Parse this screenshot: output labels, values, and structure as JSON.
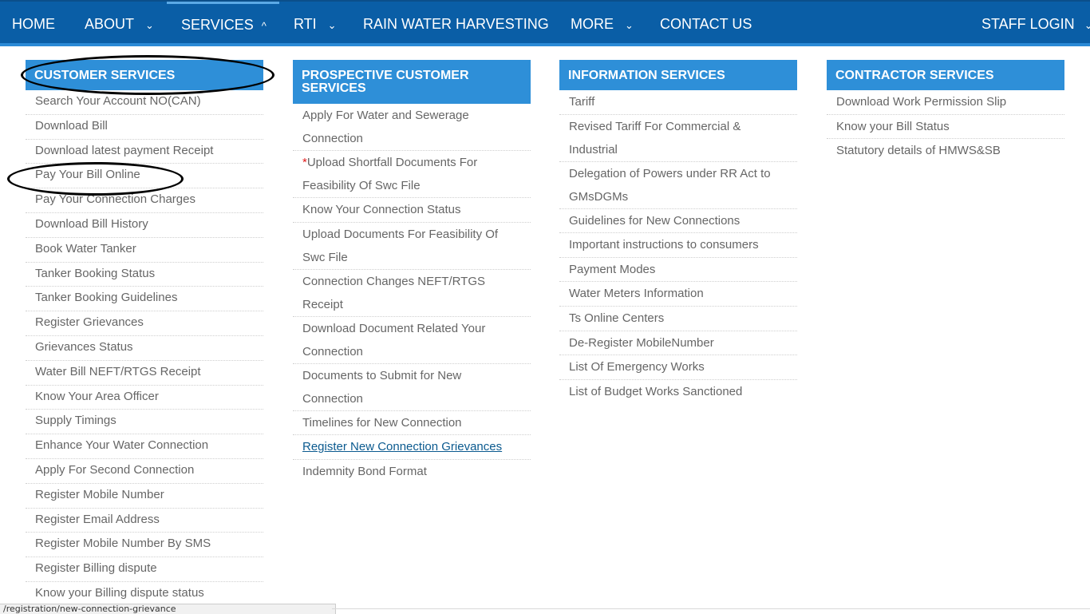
{
  "nav": {
    "home": "HOME",
    "about": "ABOUT",
    "services": "SERVICES",
    "rti": "RTI",
    "rain": "RAIN WATER HARVESTING",
    "more": "MORE",
    "contact": "CONTACT US",
    "staff": "STAFF LOGIN",
    "chevron_down": "⌄",
    "chevron_up": "^"
  },
  "customer": {
    "title": "CUSTOMER SERVICES",
    "items": [
      "Search Your Account NO(CAN)",
      "Download Bill",
      "Download latest payment Receipt",
      "Pay Your Bill Online",
      "Pay Your Connection Charges",
      "Download Bill History",
      "Book Water Tanker",
      "Tanker Booking Status",
      "Tanker Booking Guidelines",
      "Register Grievances",
      "Grievances Status",
      "Water Bill NEFT/RTGS Receipt",
      "Know Your Area Officer",
      "Supply Timings",
      "Enhance Your Water Connection",
      "Apply For Second Connection",
      "Register Mobile Number",
      "Register Email Address",
      "Register Mobile Number By SMS",
      "Register Billing dispute",
      "Know your Billing dispute status"
    ]
  },
  "prospective": {
    "title": "PROSPECTIVE CUSTOMER SERVICES",
    "required_mark": "*",
    "items": [
      "Apply For Water and Sewerage Connection",
      "Upload Shortfall Documents For Feasibility Of Swc File",
      "Know Your Connection Status",
      "Upload Documents For Feasibility Of Swc File",
      "Connection Changes NEFT/RTGS Receipt",
      "Download Document Related Your Connection",
      "Documents to Submit for New Connection",
      "Timelines for New Connection",
      "Register New Connection Grievances",
      "Indemnity Bond Format"
    ]
  },
  "information": {
    "title": "INFORMATION SERVICES",
    "items": [
      "Tariff",
      "Revised Tariff For Commercial & Industrial",
      "Delegation of Powers under RR Act to GMsDGMs",
      "Guidelines for New Connections",
      "Important instructions to consumers",
      "Payment Modes",
      "Water Meters Information",
      "Ts Online Centers",
      "De-Register MobileNumber",
      "List Of Emergency Works",
      "List of Budget Works Sanctioned"
    ]
  },
  "contractor": {
    "title": "CONTRACTOR SERVICES",
    "items": [
      "Download Work Permission Slip",
      "Know your Bill Status",
      "Statutory details of HMWS&SB"
    ]
  },
  "status_url": "/registration/new-connection-grievance"
}
